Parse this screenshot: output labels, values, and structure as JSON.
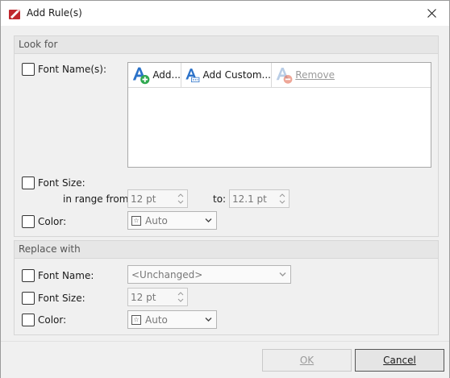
{
  "window": {
    "title": "Add Rule(s)"
  },
  "look_for": {
    "header": "Look for",
    "font_names_label": "Font Name(s):",
    "toolbar": {
      "add_label": "Add...",
      "add_custom_label": "Add Custom...",
      "remove_label": "Remove"
    },
    "font_size_label": "Font Size:",
    "range_from_label": "in range from:",
    "range_from_value": "12 pt",
    "to_label": "to:",
    "to_value": "12.1 pt",
    "color_label": "Color:",
    "color_value": "Auto"
  },
  "replace_with": {
    "header": "Replace with",
    "font_name_label": "Font Name:",
    "font_name_value": "<Unchanged>",
    "font_size_label": "Font Size:",
    "font_size_value": "12 pt",
    "color_label": "Color:",
    "color_value": "Auto"
  },
  "buttons": {
    "ok": "OK",
    "cancel": "Cancel"
  },
  "colors": {
    "accent_green": "#2fa84f",
    "icon_blue": "#2b72c9",
    "remove_red": "#e36b52"
  }
}
